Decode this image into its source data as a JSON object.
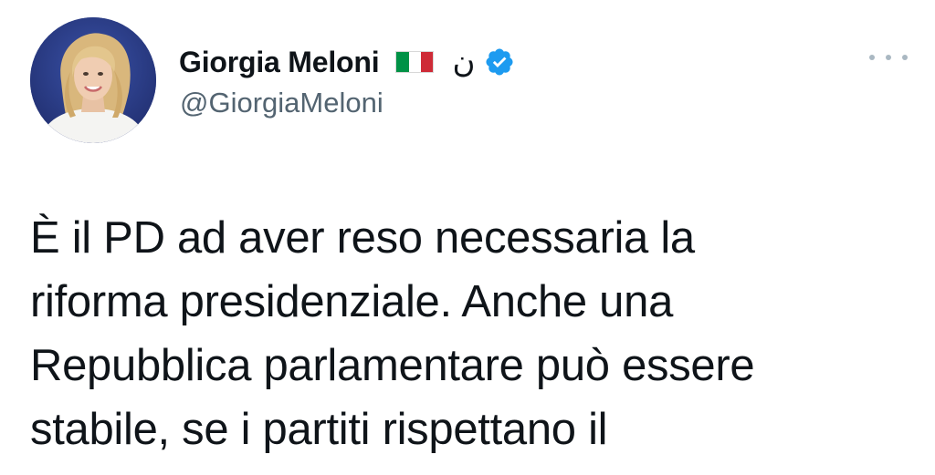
{
  "tweet": {
    "author": {
      "display_name": "Giorgia Meloni",
      "flag_emoji": "🇮🇹",
      "arabic_letter": "ن",
      "handle": "@GiorgiaMeloni",
      "avatar_icon": "profile-photo",
      "verified_icon": "verified-badge-icon"
    },
    "more_icon": "more-options-icon",
    "text_lines": [
      "È il PD ad aver reso necessaria la",
      "riforma presidenziale. Anche una",
      "Repubblica parlamentare può essere",
      "stabile, se i partiti rispettano il"
    ],
    "colors": {
      "text": "#0f1419",
      "secondary": "#536471",
      "verified": "#1d9bf0",
      "flag_green": "#009246",
      "flag_white": "#ffffff",
      "flag_red": "#ce2b37"
    }
  }
}
